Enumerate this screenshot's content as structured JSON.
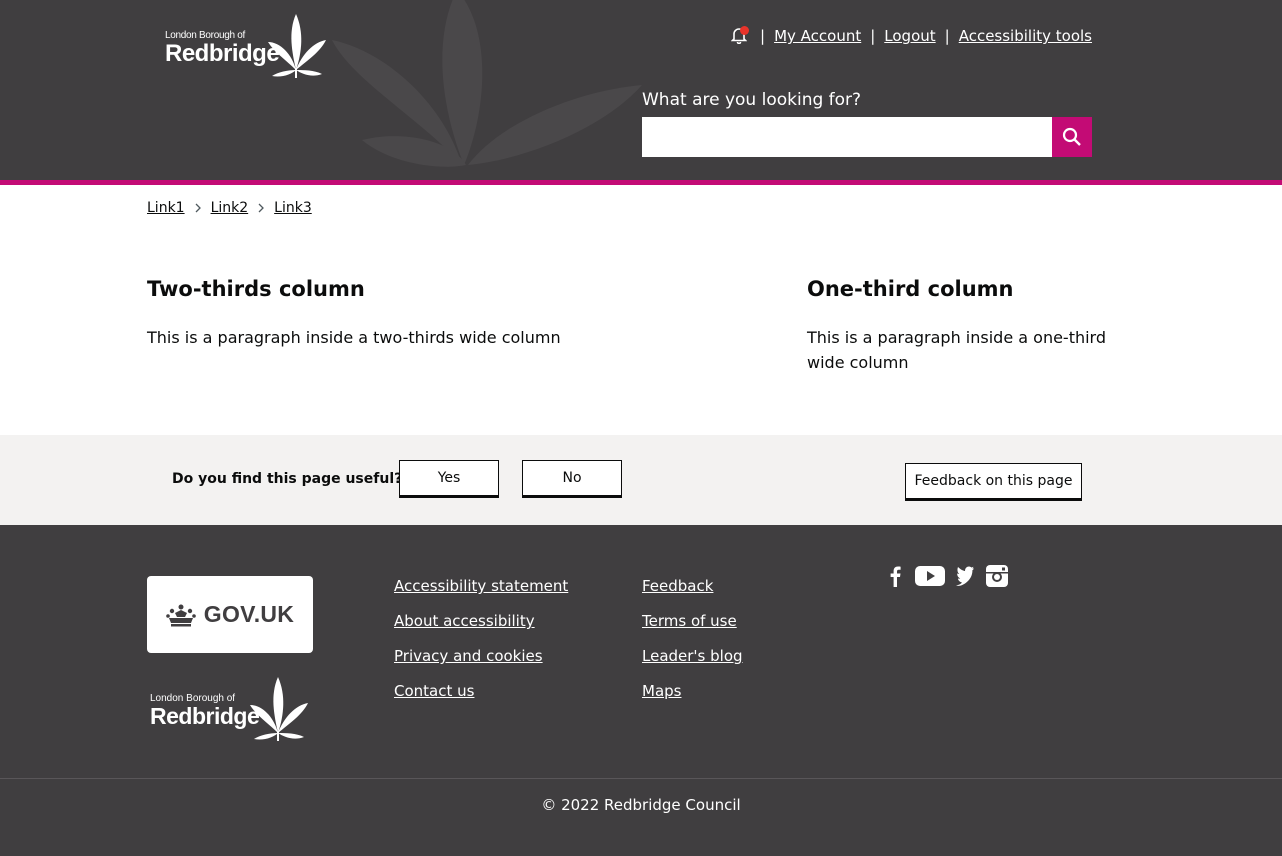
{
  "header": {
    "logo_small": "London Borough of",
    "logo_big": "Redbridge",
    "nav": {
      "my_account": "My Account",
      "logout": "Logout",
      "accessibility_tools": "Accessibility tools"
    },
    "search": {
      "label": "What are you looking for?",
      "value": "",
      "placeholder": ""
    }
  },
  "breadcrumb": [
    "Link1",
    "Link2",
    "Link3"
  ],
  "main": {
    "two_thirds": {
      "heading": "Two-thirds column",
      "text": "This is a paragraph inside a two-thirds wide column"
    },
    "one_third": {
      "heading": "One-third column",
      "text": "This is a paragraph inside a one-third wide column"
    }
  },
  "feedback": {
    "question": "Do you find this page useful?",
    "yes": "Yes",
    "no": "No",
    "feedback_link": "Feedback on this page"
  },
  "footer": {
    "gov_uk": "GOV.UK",
    "logo_small": "London Borough of",
    "logo_big": "Redbridge",
    "links_col1": [
      "Accessibility statement",
      "About accessibility",
      "Privacy and cookies",
      "Contact us"
    ],
    "links_col2": [
      "Feedback",
      "Terms of use",
      "Leader's blog",
      "Maps"
    ],
    "social_icons": [
      "facebook-icon",
      "youtube-icon",
      "twitter-icon",
      "instagram-icon"
    ],
    "copyright": "© 2022 Redbridge Council"
  },
  "colors": {
    "header_bg": "#403e40",
    "accent": "#c30b75",
    "notification": "#e8332a",
    "feedback_bg": "#f3f2f1"
  }
}
